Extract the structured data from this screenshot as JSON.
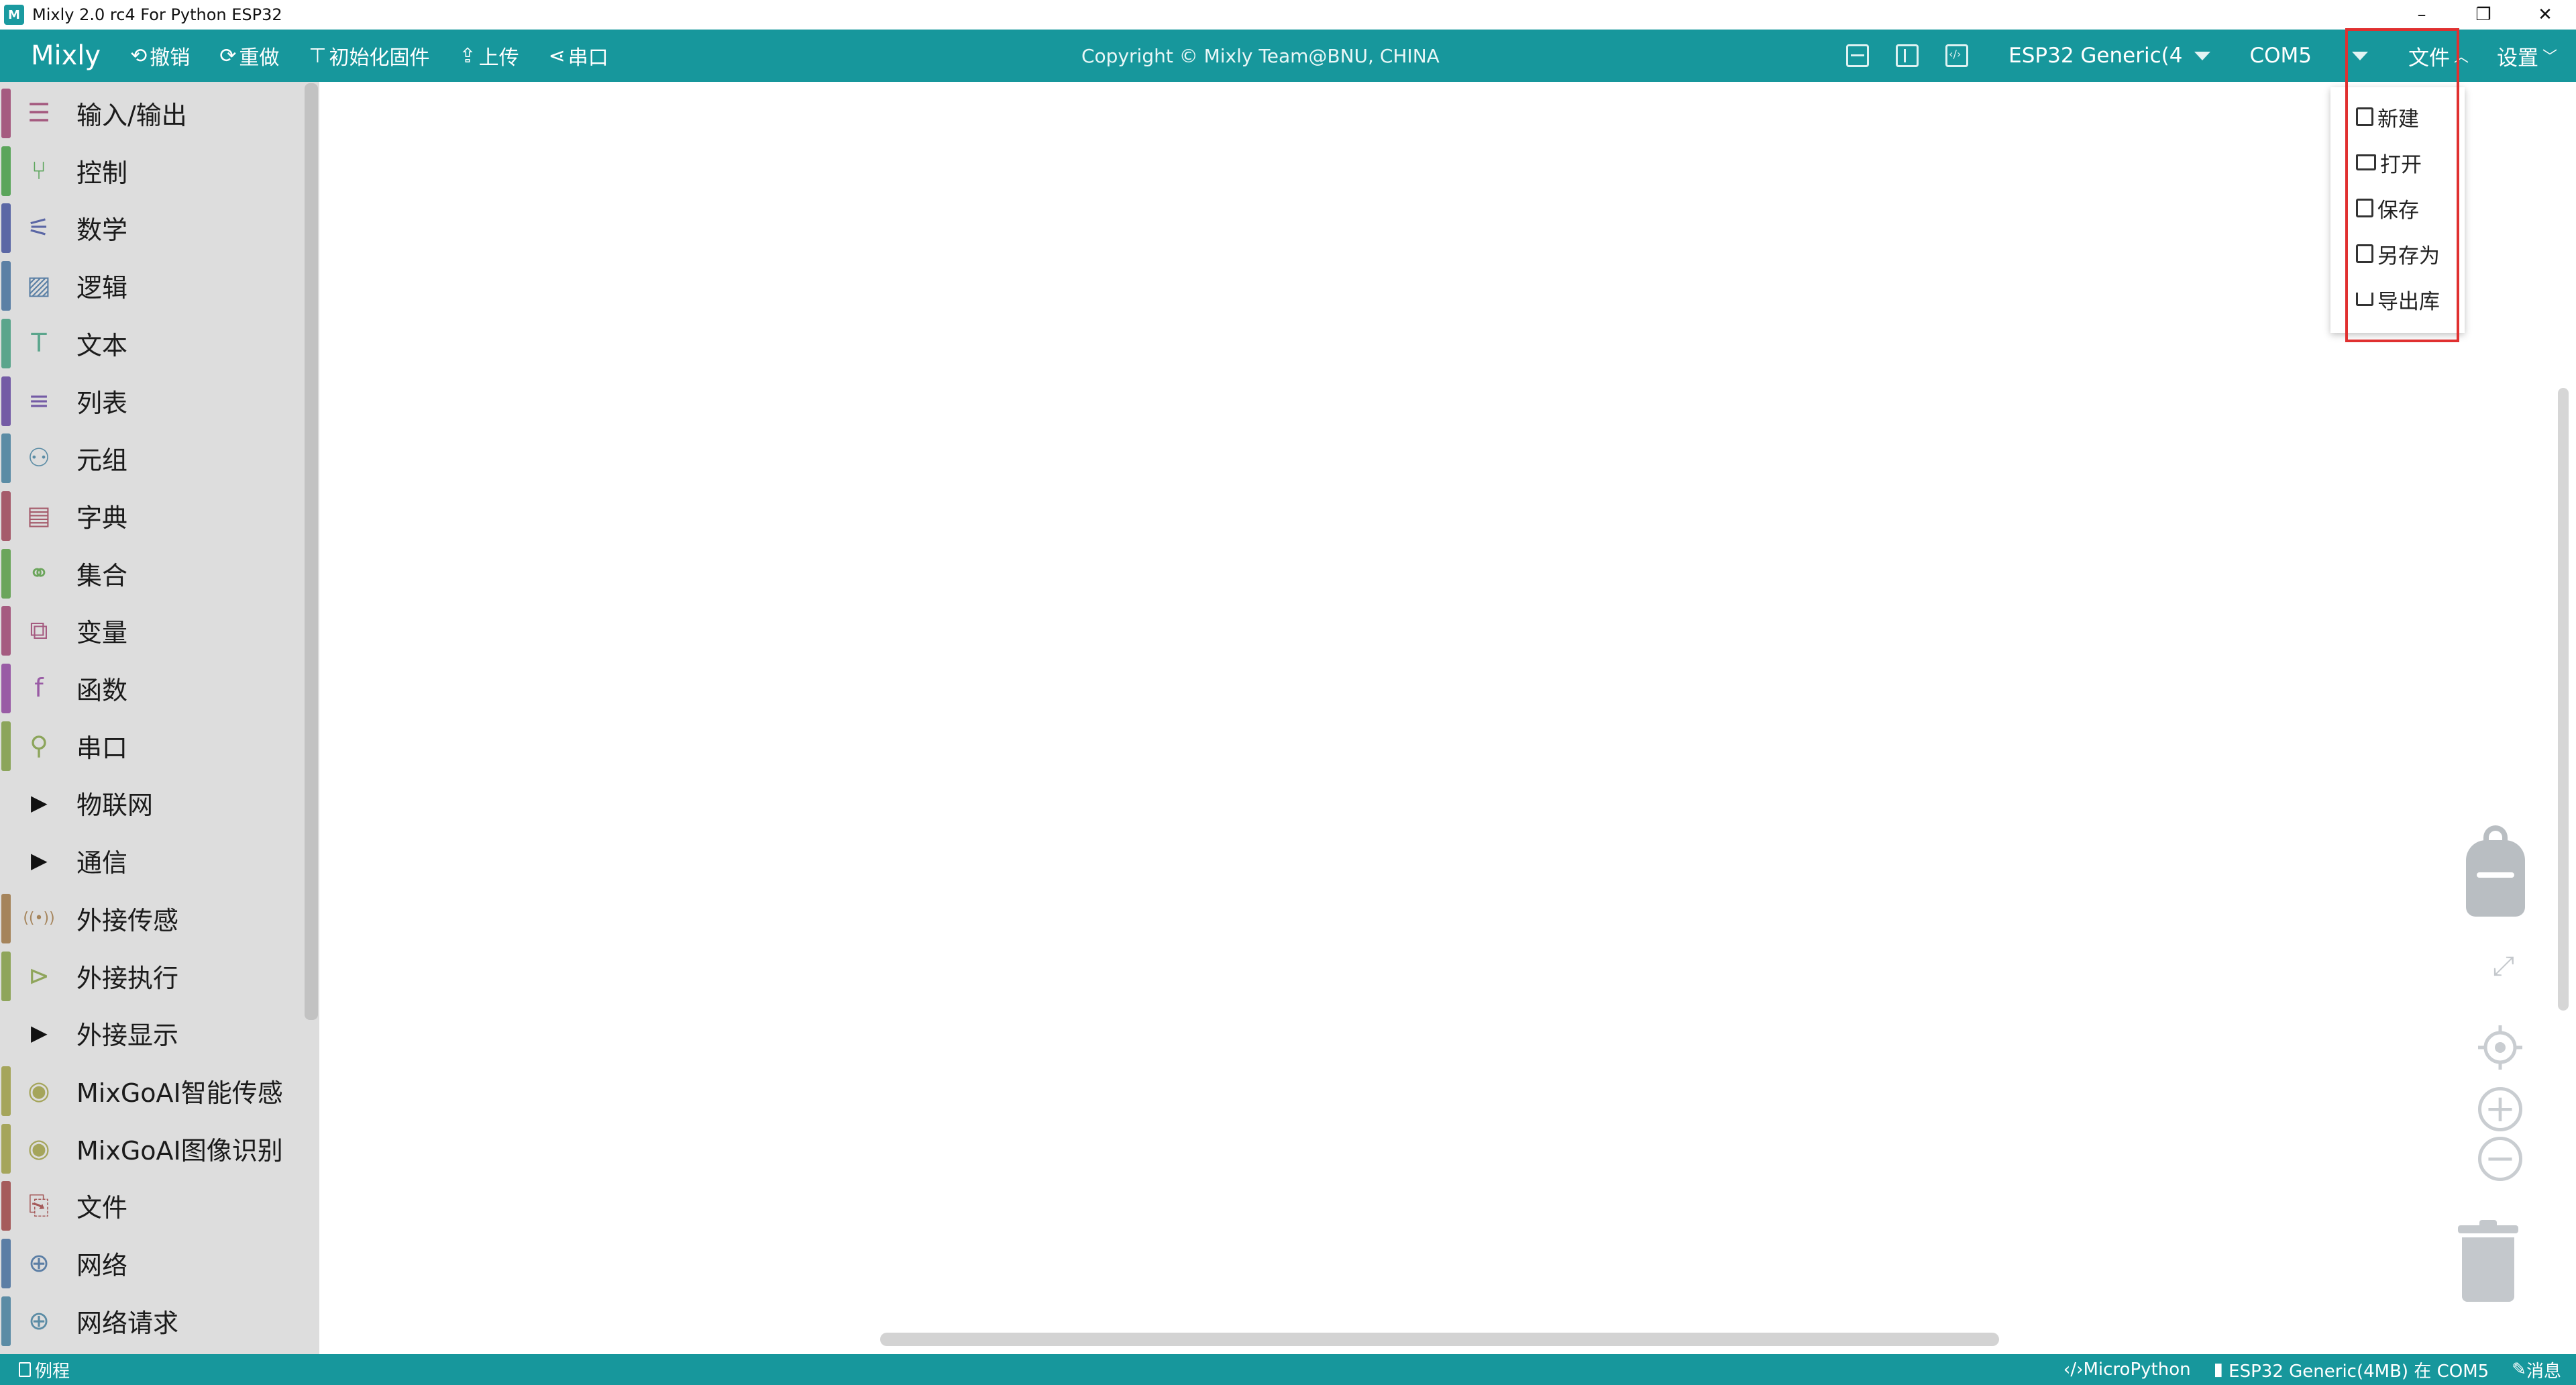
{
  "window": {
    "title": "Mixly 2.0 rc4 For Python ESP32",
    "app_icon_text": "M",
    "controls": [
      "–",
      "❐",
      "✕"
    ]
  },
  "toolbar": {
    "brand": "Mixly",
    "buttons": [
      {
        "icon": "undo-icon",
        "glyph": "⟲",
        "label": "撤销"
      },
      {
        "icon": "redo-icon",
        "glyph": "⟳",
        "label": "重做"
      },
      {
        "icon": "init-firmware-icon",
        "glyph": "⊤",
        "label": "初始化固件"
      },
      {
        "icon": "upload-icon",
        "glyph": "⇪",
        "label": "上传"
      },
      {
        "icon": "serial-port-icon",
        "glyph": "⋖",
        "label": "串口"
      }
    ],
    "copyright": "Copyright © Mixly Team@BNU, CHINA",
    "board": "ESP32 Generic(4",
    "port": "COM5",
    "file_menu": "文件",
    "settings_menu": "设置",
    "accent": "#17979c"
  },
  "sidebar": {
    "categories": [
      {
        "label": "输入/输出",
        "color": "#a55b80",
        "icon": "☰",
        "icon_name": "input-output-icon",
        "expandable": false
      },
      {
        "label": "控制",
        "color": "#5ba55b",
        "icon": "⑂",
        "icon_name": "control-icon",
        "expandable": false
      },
      {
        "label": "数学",
        "color": "#5b67a5",
        "icon": "⚟",
        "icon_name": "math-icon",
        "expandable": false
      },
      {
        "label": "逻辑",
        "color": "#5b80a5",
        "icon": "▨",
        "icon_name": "logic-icon",
        "expandable": false
      },
      {
        "label": "文本",
        "color": "#5ba58c",
        "icon": "T",
        "icon_name": "text-icon",
        "expandable": false
      },
      {
        "label": "列表",
        "color": "#745ba5",
        "icon": "≡",
        "icon_name": "list-icon",
        "expandable": false
      },
      {
        "label": "元组",
        "color": "#5b8ca5",
        "icon": "⚇",
        "icon_name": "tuple-icon",
        "expandable": false
      },
      {
        "label": "字典",
        "color": "#a55b6b",
        "icon": "▤",
        "icon_name": "dictionary-icon",
        "expandable": false
      },
      {
        "label": "集合",
        "color": "#6ba55b",
        "icon": "⚭",
        "icon_name": "set-icon",
        "expandable": false
      },
      {
        "label": "变量",
        "color": "#a55b80",
        "icon": "⧉",
        "icon_name": "variable-icon",
        "expandable": false
      },
      {
        "label": "函数",
        "color": "#995ba5",
        "icon": "f",
        "icon_name": "function-icon",
        "expandable": false
      },
      {
        "label": "串口",
        "color": "#8ca55b",
        "icon": "⚲",
        "icon_name": "serial-icon",
        "expandable": false
      },
      {
        "label": "物联网",
        "color": "#dddddd",
        "icon": "▶",
        "icon_name": "expand-arrow-icon",
        "expandable": true
      },
      {
        "label": "通信",
        "color": "#dddddd",
        "icon": "▶",
        "icon_name": "expand-arrow-icon",
        "expandable": true
      },
      {
        "label": "外接传感",
        "color": "#a5845b",
        "icon": "((•))",
        "icon_name": "external-sensor-icon",
        "expandable": false
      },
      {
        "label": "外接执行",
        "color": "#8fa55b",
        "icon": "⊳",
        "icon_name": "external-actuator-icon",
        "expandable": false
      },
      {
        "label": "外接显示",
        "color": "#dddddd",
        "icon": "▶",
        "icon_name": "expand-arrow-icon",
        "expandable": true
      },
      {
        "label": "MixGoAI智能传感",
        "color": "#a5a55b",
        "icon": "◉",
        "icon_name": "ai-sensor-icon",
        "expandable": false
      },
      {
        "label": "MixGoAI图像识别",
        "color": "#a5a55b",
        "icon": "◉",
        "icon_name": "ai-vision-icon",
        "expandable": false
      },
      {
        "label": "文件",
        "color": "#a55b5b",
        "icon": "⎘",
        "icon_name": "file-icon",
        "expandable": false
      },
      {
        "label": "网络",
        "color": "#5b7ea5",
        "icon": "⊕",
        "icon_name": "network-icon",
        "expandable": false
      },
      {
        "label": "网络请求",
        "color": "#5b8ca5",
        "icon": "⊕",
        "icon_name": "network-request-icon",
        "expandable": false
      }
    ]
  },
  "file_menu": {
    "items": [
      {
        "label": "新建",
        "icon_name": "new-file-icon"
      },
      {
        "label": "打开",
        "icon_name": "open-folder-icon"
      },
      {
        "label": "保存",
        "icon_name": "save-icon"
      },
      {
        "label": "另存为",
        "icon_name": "save-as-icon"
      },
      {
        "label": "导出库",
        "icon_name": "export-library-icon"
      }
    ]
  },
  "status": {
    "examples": "例程",
    "language": "MicroPython",
    "connection": "ESP32 Generic(4MB) 在 COM5",
    "messages": "消息"
  }
}
